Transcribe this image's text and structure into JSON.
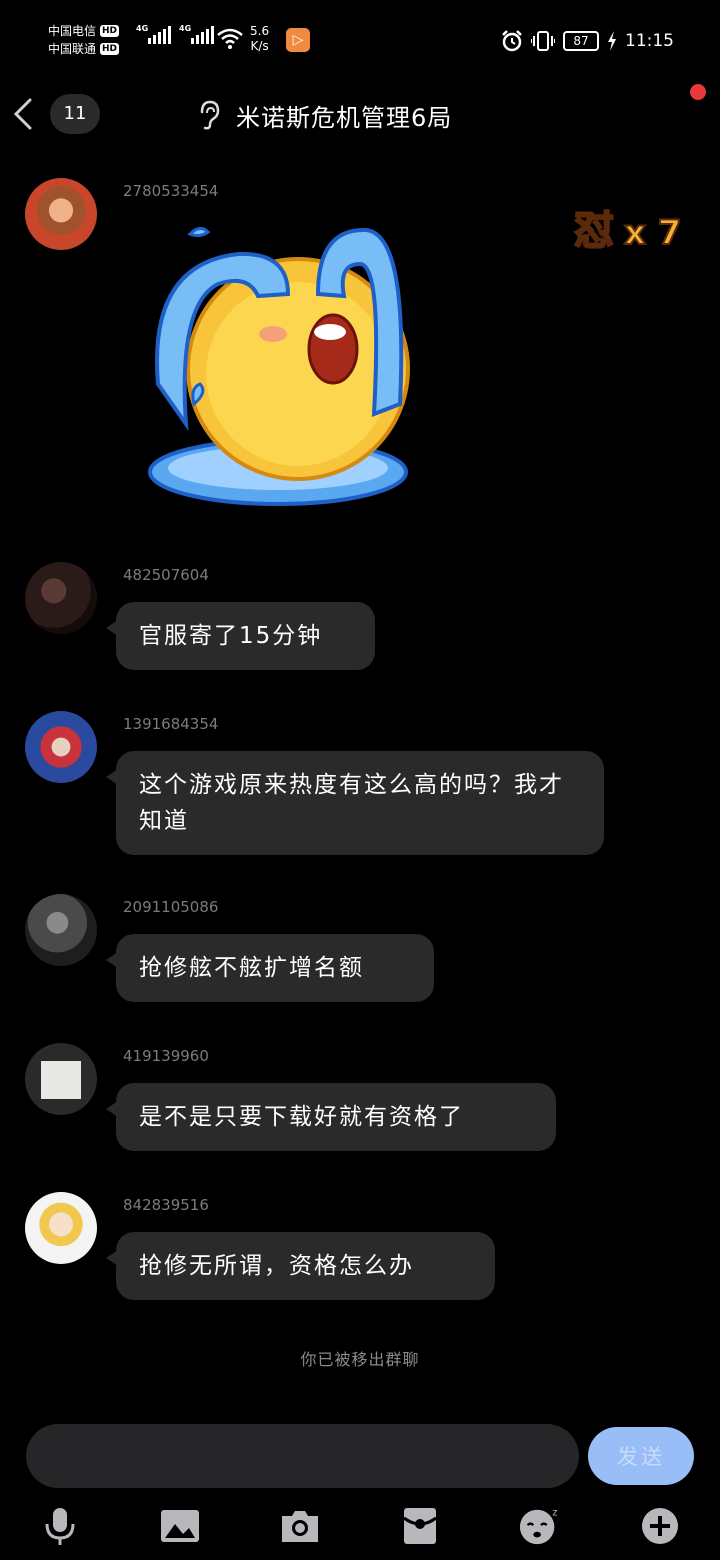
{
  "status_bar": {
    "carrier1": "中国电信",
    "carrier2": "中国联通",
    "hd": "HD",
    "net_type": "4G",
    "speed_value": "5.6",
    "speed_unit": "K/s",
    "battery": "87",
    "time": "11:15"
  },
  "header": {
    "unread_count": "11",
    "title": "米诺斯危机管理6局"
  },
  "combo": {
    "label": "怼",
    "count": "x 7"
  },
  "messages": [
    {
      "sender": "2780533454",
      "type": "sticker",
      "sticker": "crying-emoji-sticker"
    },
    {
      "sender": "482507604",
      "text": "官服寄了15分钟"
    },
    {
      "sender": "1391684354",
      "text": "这个游戏原来热度有这么高的吗？我才知道"
    },
    {
      "sender": "2091105086",
      "text": "抢修舷不舷扩增名额"
    },
    {
      "sender": "419139960",
      "text": "是不是只要下载好就有资格了"
    },
    {
      "sender": "842839516",
      "text": "抢修无所谓，资格怎么办"
    }
  ],
  "system_notice": "你已被移出群聊",
  "input": {
    "placeholder": "",
    "send_label": "发送"
  },
  "toolbar": [
    "microphone-icon",
    "image-icon",
    "camera-icon",
    "red-packet-icon",
    "emoji-icon",
    "plus-icon"
  ],
  "colors": {
    "background": "#000000",
    "bubble": "#2a2a2b",
    "sender": "#7b7b80",
    "send_button": "#99bdf6",
    "red_dot": "#e83a3a"
  }
}
